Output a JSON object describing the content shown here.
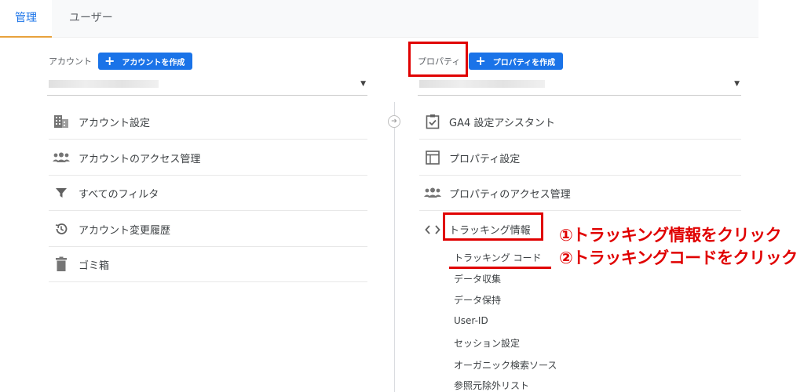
{
  "tabs": {
    "admin": "管理",
    "users": "ユーザー"
  },
  "account": {
    "label": "アカウント",
    "create_button": "アカウントを作成",
    "create_plus": "+",
    "caret": "▼",
    "items": [
      {
        "label": "アカウント設定",
        "icon": "building-icon"
      },
      {
        "label": "アカウントのアクセス管理",
        "icon": "people-icon"
      },
      {
        "label": "すべてのフィルタ",
        "icon": "filter-icon"
      },
      {
        "label": "アカウント変更履歴",
        "icon": "history-icon"
      },
      {
        "label": "ゴミ箱",
        "icon": "trash-icon"
      }
    ]
  },
  "property": {
    "label": "プロパティ",
    "create_button": "プロパティを作成",
    "create_plus": "+",
    "caret": "▼",
    "items": [
      {
        "label": "GA4 設定アシスタント",
        "icon": "checklist-icon"
      },
      {
        "label": "プロパティ設定",
        "icon": "window-icon"
      },
      {
        "label": "プロパティのアクセス管理",
        "icon": "people-icon"
      },
      {
        "label": "トラッキング情報",
        "icon": "code-icon"
      }
    ],
    "tracking_subitems": [
      "トラッキング コード",
      "データ収集",
      "データ保持",
      "User-ID",
      "セッション設定",
      "オーガニック検索ソース",
      "参照元除外リスト"
    ]
  },
  "annotations": {
    "step1": "①トラッキング情報をクリック",
    "step2": "②トラッキングコードをクリック",
    "color": "#e00000"
  },
  "colors": {
    "accent": "#1a73e8",
    "tab_indicator": "#e8a13c"
  }
}
